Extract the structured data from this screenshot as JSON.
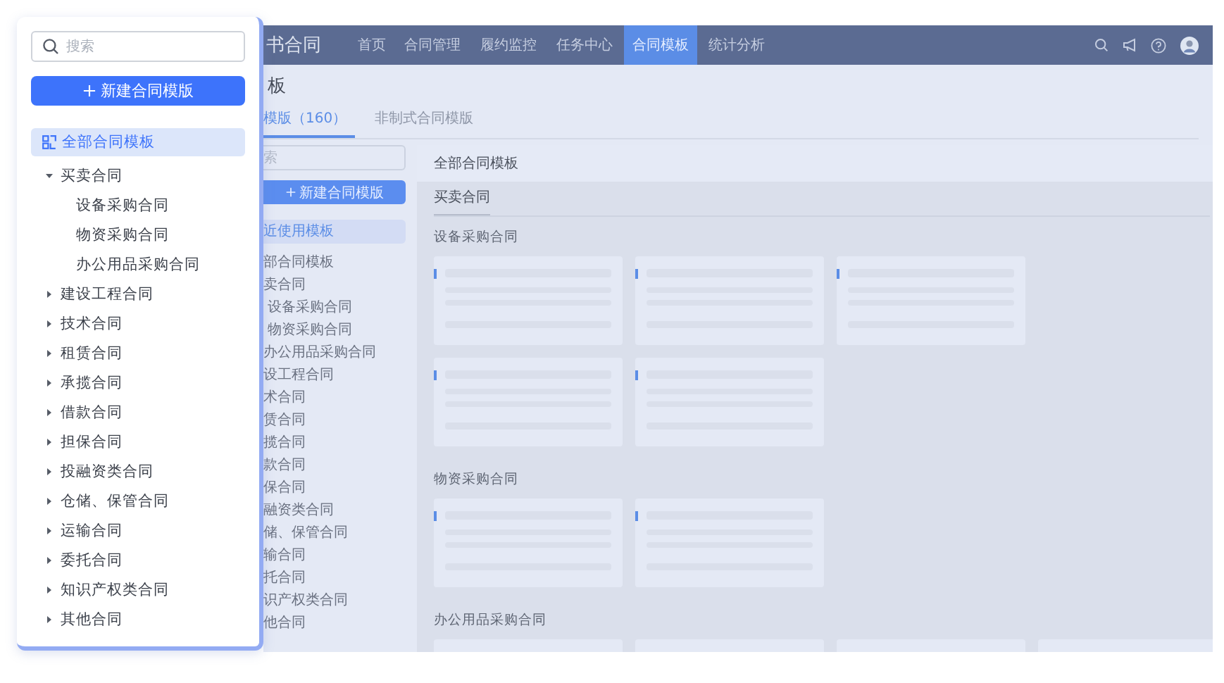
{
  "app": {
    "logo": "书合同",
    "nav": [
      {
        "label": "首页",
        "selected": false
      },
      {
        "label": "合同管理",
        "selected": false
      },
      {
        "label": "履约监控",
        "selected": false
      },
      {
        "label": "任务中心",
        "selected": false
      },
      {
        "label": "合同模板",
        "selected": true
      },
      {
        "label": "统计分析",
        "selected": false
      }
    ],
    "page_title": "板",
    "tabs": [
      {
        "label": "模版（160）",
        "selected": true
      },
      {
        "label": "非制式合同模版",
        "selected": false
      }
    ],
    "sidebar": {
      "search": {
        "placeholder": "索"
      },
      "new_button": "新建合同模版",
      "items": [
        {
          "label": "近使用模板",
          "selected": true
        },
        {
          "label": "部合同模板",
          "selected": false
        },
        {
          "label": "卖合同",
          "selected": false,
          "children": [
            {
              "label": "设备采购合同",
              "selected": false
            },
            {
              "label": "物资采购合同",
              "selected": false
            }
          ]
        },
        {
          "label": "办公用品采购合同",
          "selected": false
        },
        {
          "label": "设工程合同",
          "selected": false
        },
        {
          "label": "术合同",
          "selected": false
        },
        {
          "label": "赁合同",
          "selected": false
        },
        {
          "label": "揽合同",
          "selected": false
        },
        {
          "label": "款合同",
          "selected": false
        },
        {
          "label": "保合同",
          "selected": false
        },
        {
          "label": "融资类合同",
          "selected": false
        },
        {
          "label": "储、保管合同",
          "selected": false
        },
        {
          "label": "输合同",
          "selected": false
        },
        {
          "label": "托合同",
          "selected": false
        },
        {
          "label": "识产权类合同",
          "selected": false
        },
        {
          "label": "他合同",
          "selected": false
        }
      ]
    },
    "panel": {
      "title": "全部合同模板",
      "tabs": [
        {
          "label": "买卖合同",
          "selected": true
        }
      ],
      "sections": [
        {
          "title": "设备采购合同",
          "rows": [
            {
              "cards": [
                {
                  "kind": "skeleton"
                },
                {
                  "kind": "skeleton"
                },
                {
                  "kind": "skeleton"
                }
              ]
            },
            {
              "cards": [
                {
                  "kind": "skeleton"
                },
                {
                  "kind": "skeleton"
                }
              ]
            }
          ]
        },
        {
          "title": "物资采购合同",
          "rows": [
            {
              "cards": [
                {
                  "kind": "skeleton"
                },
                {
                  "kind": "skeleton"
                }
              ]
            }
          ]
        },
        {
          "title": "办公用品采购合同",
          "rows": [
            {
              "cards": [
                {
                  "kind": "skeleton"
                },
                {
                  "kind": "skeleton"
                },
                {
                  "kind": "skeleton"
                },
                {
                  "kind": "skeleton"
                }
              ]
            }
          ]
        }
      ]
    }
  },
  "popup": {
    "search": {
      "placeholder": "搜索"
    },
    "new_button": "新建合同模版",
    "tree": [
      {
        "label": "全部合同模板",
        "kind": "all",
        "selected": true
      },
      {
        "label": "买卖合同",
        "kind": "category",
        "selected": false,
        "expanded": true,
        "children": [
          {
            "label": "设备采购合同",
            "selected": false
          },
          {
            "label": "物资采购合同",
            "selected": false
          },
          {
            "label": "办公用品采购合同",
            "selected": false
          }
        ]
      },
      {
        "label": "建设工程合同",
        "kind": "category",
        "selected": false,
        "expanded": false
      },
      {
        "label": "技术合同",
        "kind": "category",
        "selected": false,
        "expanded": false
      },
      {
        "label": "租赁合同",
        "kind": "category",
        "selected": false,
        "expanded": false
      },
      {
        "label": "承揽合同",
        "kind": "category",
        "selected": false,
        "expanded": false
      },
      {
        "label": "借款合同",
        "kind": "category",
        "selected": false,
        "expanded": false
      },
      {
        "label": "担保合同",
        "kind": "category",
        "selected": false,
        "expanded": false
      },
      {
        "label": "投融资类合同",
        "kind": "category",
        "selected": false,
        "expanded": false
      },
      {
        "label": "仓储、保管合同",
        "kind": "category",
        "selected": false,
        "expanded": false
      },
      {
        "label": "运输合同",
        "kind": "category",
        "selected": false,
        "expanded": false
      },
      {
        "label": "委托合同",
        "kind": "category",
        "selected": false,
        "expanded": false
      },
      {
        "label": "知识产权类合同",
        "kind": "category",
        "selected": false,
        "expanded": false
      },
      {
        "label": "其他合同",
        "kind": "category",
        "selected": false,
        "expanded": false
      }
    ]
  }
}
